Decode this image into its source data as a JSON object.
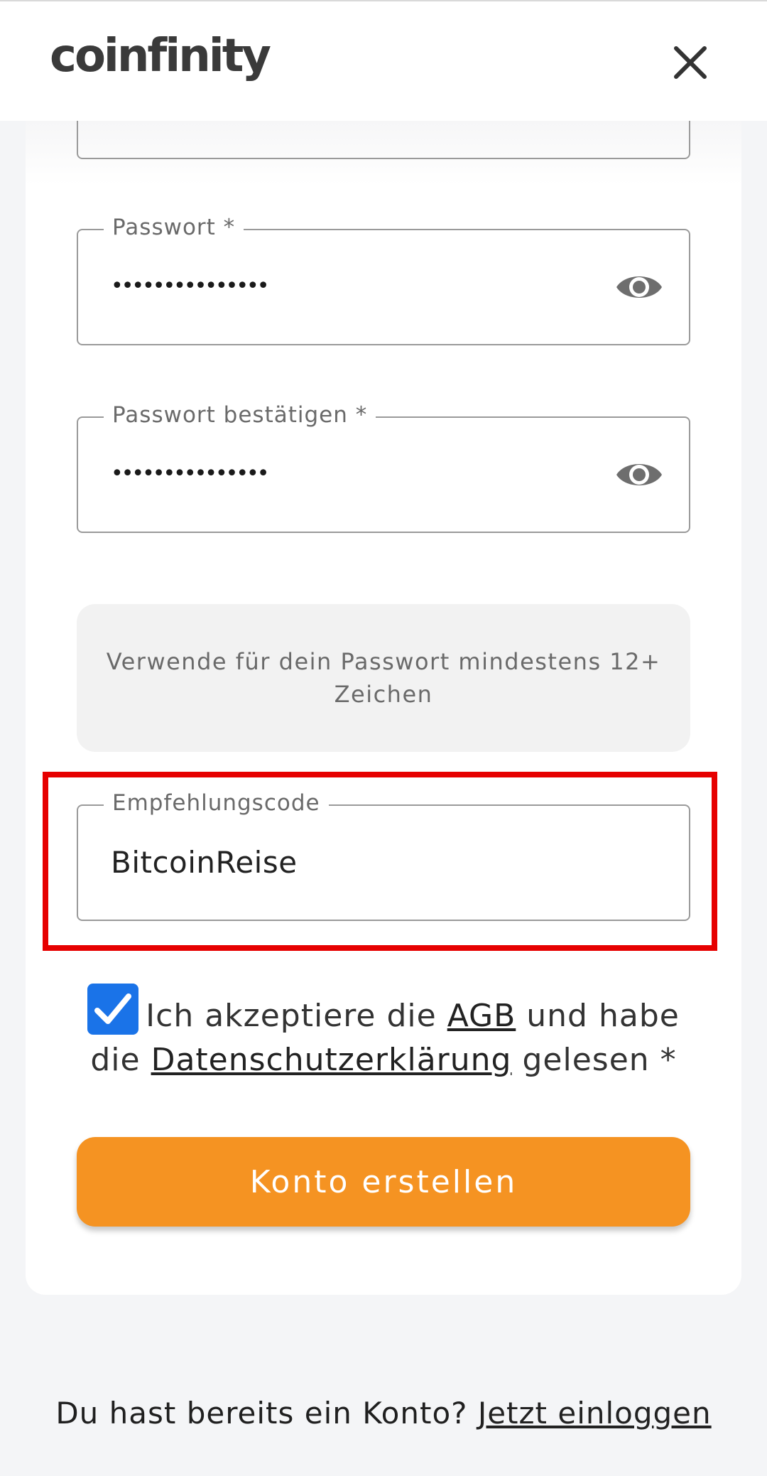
{
  "header": {
    "logo_text": "coinfinity",
    "close_icon": "close-icon"
  },
  "form": {
    "password": {
      "label": "Passwort *",
      "value": "•••••••••••••••",
      "toggle_icon": "eye-icon"
    },
    "confirm_password": {
      "label": "Passwort bestätigen *",
      "value": "•••••••••••••••",
      "toggle_icon": "eye-icon"
    },
    "hint": "Verwende für dein Passwort mindestens 12+ Zeichen",
    "referral": {
      "label": "Empfehlungscode",
      "value": "BitcoinReise"
    },
    "consent": {
      "checked": true,
      "text_1": "Ich akzeptiere die ",
      "agb_link": "AGB",
      "text_2": " und habe die ",
      "privacy_link": "Datenschutzerklärung",
      "text_3": " gelesen *"
    },
    "submit_label": "Konto erstellen"
  },
  "footer": {
    "question": "Du hast bereits ein Konto? ",
    "login_link": "Jetzt einloggen"
  },
  "colors": {
    "accent": "#f59322",
    "checkbox": "#1a73e8",
    "highlight": "#e60000"
  }
}
